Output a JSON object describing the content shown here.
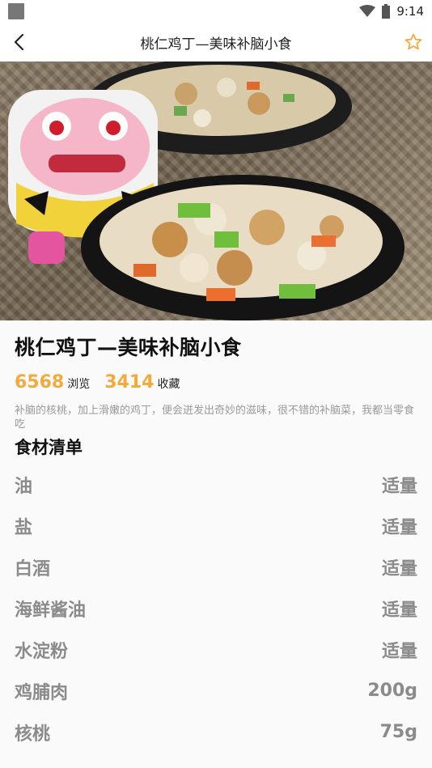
{
  "status": {
    "time": "9:14"
  },
  "header": {
    "title": "桃仁鸡丁—美味补脑小食"
  },
  "recipe": {
    "title": "桃仁鸡丁—美味补脑小食",
    "views": "6568",
    "views_label": "浏览",
    "favorites": "3414",
    "favorites_label": "收藏",
    "description": "补脑的核桃，加上滑嫩的鸡丁，便会迸发出奇妙的滋味，很不错的补脑菜，我都当零食吃"
  },
  "ingredients": {
    "title": "食材清单",
    "items": [
      {
        "name": "油",
        "amount": "适量"
      },
      {
        "name": "盐",
        "amount": "适量"
      },
      {
        "name": "白酒",
        "amount": "适量"
      },
      {
        "name": "海鲜酱油",
        "amount": "适量"
      },
      {
        "name": "水淀粉",
        "amount": "适量"
      },
      {
        "name": "鸡脯肉",
        "amount": "200g"
      },
      {
        "name": "核桃",
        "amount": "75g"
      }
    ]
  },
  "colors": {
    "accent": "#f4a93b",
    "star": "#f4a93b"
  }
}
